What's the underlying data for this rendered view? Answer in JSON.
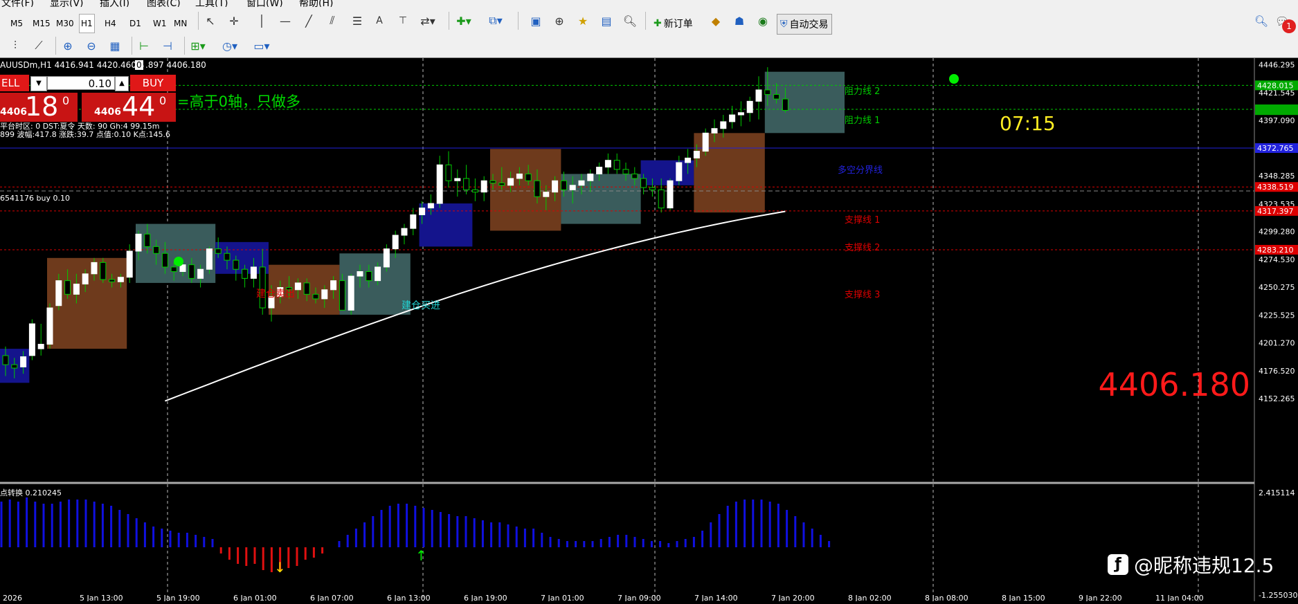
{
  "menu": [
    "文件(F)",
    "显示(V)",
    "插入(I)",
    "图表(C)",
    "工具(T)",
    "窗口(W)",
    "帮助(H)"
  ],
  "timeframes": [
    "M5",
    "M15",
    "M30",
    "H1",
    "H4",
    "D1",
    "W1",
    "MN"
  ],
  "active_timeframe": "H1",
  "toolbar": {
    "new_order_label": "新订单",
    "auto_trading_label": "自动交易",
    "notification_count": "1"
  },
  "chart_header": {
    "symbol_prefix": "AUUSDm,H1",
    "ohlc_partial": "4416.941 4420.460 4",
    "ohlc_badge": "0",
    "ohlc_rest": ".897 4406.180"
  },
  "trade_panel": {
    "sell_label": "ELL",
    "buy_label": "BUY",
    "lot_value": "0.10",
    "sell_prefix": "4406",
    "sell_big": "18",
    "sell_sup": "0",
    "buy_prefix": "4406",
    "buy_big": "44",
    "buy_sup": "0"
  },
  "info_lines": {
    "rule_text": "=高于0轴，只做多",
    "line1": "平台时区: 0  DST:夏令 天数: 90  Gh:4  99.15m",
    "line2": "899  波幅:417.8  涨跌:39.7  点值:0.10  K点:145.6",
    "order_line": "6541176 buy 0.10",
    "countdown": "07:15",
    "big_price": "4406.180"
  },
  "annotations": {
    "resist2": "阻力线 2",
    "resist1": "阻力线 1",
    "pivot": "多空分界线",
    "support1": "支撑线 1",
    "support2": "支撑线 2",
    "support3": "支撑线 3",
    "open_short": "建仓卖出",
    "open_long": "建仓买进"
  },
  "price_axis": {
    "ticks": [
      "4446.295",
      "4421.545",
      "4397.090",
      "4348.285",
      "4323.535",
      "4299.280",
      "4274.530",
      "4250.275",
      "4225.525",
      "4201.270",
      "4176.520",
      "4152.265"
    ],
    "tags": [
      "4428.015",
      "4406.893",
      "4372.765",
      "4338.519",
      "4317.397",
      "4283.210"
    ]
  },
  "indicator": {
    "label": "点转换 0.210245",
    "axis_top": "2.415114",
    "axis_bottom": "-1.255030"
  },
  "time_axis": [
    "2026",
    "5 Jan 13:00",
    "5 Jan 19:00",
    "6 Jan 01:00",
    "6 Jan 07:00",
    "6 Jan 13:00",
    "6 Jan 19:00",
    "7 Jan 01:00",
    "7 Jan 09:00",
    "7 Jan 14:00",
    "7 Jan 20:00",
    "8 Jan 02:00",
    "8 Jan 08:00",
    "8 Jan 15:00",
    "9 Jan 22:00",
    "11 Jan 04:00"
  ],
  "watermark": "@昵称违规12.5",
  "colors": {
    "background": "#000000",
    "bull": "#ffffff",
    "wick": "#00cc00",
    "resistance": "#00cc00",
    "support": "#dd0000",
    "pivot": "#2222dd",
    "box_brown": "#6e3a1c",
    "box_teal": "#3a5c5c",
    "box_blue": "#14148c",
    "hist_blue": "#1010e0",
    "hist_red": "#e01010"
  },
  "chart_data": {
    "type": "candlestick",
    "price_range": [
      4140,
      4452
    ],
    "candles": [
      [
        4190,
        4198,
        4172,
        4182
      ],
      [
        4182,
        4188,
        4170,
        4179
      ],
      [
        4180,
        4194,
        4174,
        4189
      ],
      [
        4190,
        4222,
        4186,
        4218
      ],
      [
        4196,
        4218,
        4190,
        4200
      ],
      [
        4200,
        4236,
        4196,
        4232
      ],
      [
        4234,
        4262,
        4230,
        4256
      ],
      [
        4256,
        4266,
        4240,
        4244
      ],
      [
        4244,
        4262,
        4236,
        4253
      ],
      [
        4253,
        4266,
        4246,
        4262
      ],
      [
        4262,
        4276,
        4256,
        4272
      ],
      [
        4272,
        4276,
        4254,
        4257
      ],
      [
        4257,
        4262,
        4250,
        4255
      ],
      [
        4255,
        4262,
        4250,
        4259
      ],
      [
        4259,
        4288,
        4254,
        4282
      ],
      [
        4282,
        4300,
        4274,
        4297
      ],
      [
        4297,
        4306,
        4280,
        4286
      ],
      [
        4286,
        4292,
        4270,
        4280
      ],
      [
        4280,
        4290,
        4262,
        4268
      ],
      [
        4268,
        4272,
        4256,
        4264
      ],
      [
        4264,
        4274,
        4260,
        4270
      ],
      [
        4270,
        4276,
        4254,
        4258
      ],
      [
        4258,
        4270,
        4250,
        4266
      ],
      [
        4266,
        4286,
        4262,
        4284
      ],
      [
        4284,
        4294,
        4276,
        4280
      ],
      [
        4280,
        4286,
        4266,
        4274
      ],
      [
        4274,
        4278,
        4256,
        4266
      ],
      [
        4266,
        4270,
        4250,
        4258
      ],
      [
        4258,
        4276,
        4250,
        4268
      ],
      [
        4268,
        4284,
        4226,
        4232
      ],
      [
        4232,
        4252,
        4220,
        4242
      ],
      [
        4242,
        4256,
        4236,
        4250
      ],
      [
        4250,
        4260,
        4240,
        4248
      ],
      [
        4248,
        4258,
        4240,
        4254
      ],
      [
        4254,
        4258,
        4238,
        4244
      ],
      [
        4244,
        4250,
        4236,
        4240
      ],
      [
        4240,
        4252,
        4232,
        4248
      ],
      [
        4248,
        4260,
        4240,
        4256
      ],
      [
        4256,
        4262,
        4236,
        4230
      ],
      [
        4230,
        4262,
        4226,
        4260
      ],
      [
        4260,
        4270,
        4250,
        4264
      ],
      [
        4264,
        4270,
        4250,
        4256
      ],
      [
        4256,
        4272,
        4252,
        4268
      ],
      [
        4268,
        4288,
        4264,
        4284
      ],
      [
        4284,
        4300,
        4276,
        4296
      ],
      [
        4296,
        4306,
        4288,
        4302
      ],
      [
        4302,
        4320,
        4296,
        4314
      ],
      [
        4314,
        4326,
        4306,
        4320
      ],
      [
        4320,
        4332,
        4314,
        4324
      ],
      [
        4324,
        4366,
        4320,
        4358
      ],
      [
        4358,
        4370,
        4338,
        4344
      ],
      [
        4344,
        4354,
        4330,
        4346
      ],
      [
        4346,
        4358,
        4332,
        4336
      ],
      [
        4336,
        4346,
        4326,
        4334
      ],
      [
        4334,
        4348,
        4326,
        4344
      ],
      [
        4344,
        4350,
        4336,
        4342
      ],
      [
        4342,
        4356,
        4336,
        4340
      ],
      [
        4340,
        4352,
        4334,
        4346
      ],
      [
        4346,
        4356,
        4340,
        4350
      ],
      [
        4350,
        4358,
        4340,
        4344
      ],
      [
        4344,
        4354,
        4324,
        4330
      ],
      [
        4330,
        4340,
        4318,
        4334
      ],
      [
        4334,
        4348,
        4326,
        4344
      ],
      [
        4344,
        4352,
        4330,
        4336
      ],
      [
        4336,
        4348,
        4324,
        4340
      ],
      [
        4340,
        4350,
        4332,
        4344
      ],
      [
        4344,
        4354,
        4334,
        4350
      ],
      [
        4350,
        4360,
        4344,
        4356
      ],
      [
        4356,
        4368,
        4350,
        4362
      ],
      [
        4362,
        4368,
        4350,
        4354
      ],
      [
        4354,
        4360,
        4344,
        4350
      ],
      [
        4350,
        4356,
        4340,
        4346
      ],
      [
        4346,
        4350,
        4332,
        4338
      ],
      [
        4338,
        4346,
        4330,
        4336
      ],
      [
        4336,
        4346,
        4316,
        4320
      ],
      [
        4320,
        4346,
        4318,
        4344
      ],
      [
        4344,
        4366,
        4340,
        4360
      ],
      [
        4360,
        4372,
        4350,
        4364
      ],
      [
        4364,
        4376,
        4356,
        4370
      ],
      [
        4370,
        4390,
        4366,
        4386
      ],
      [
        4386,
        4398,
        4378,
        4390
      ],
      [
        4390,
        4402,
        4382,
        4396
      ],
      [
        4396,
        4410,
        4390,
        4402
      ],
      [
        4402,
        4414,
        4392,
        4404
      ],
      [
        4404,
        4418,
        4396,
        4414
      ],
      [
        4414,
        4436,
        4398,
        4424
      ],
      [
        4424,
        4444,
        4410,
        4420
      ],
      [
        4420,
        4430,
        4412,
        4416
      ],
      [
        4416,
        4426,
        4404,
        4406
      ]
    ],
    "ma_range": [
      4150,
      4317
    ],
    "histogram": [
      2.2,
      2.3,
      2.2,
      2.4,
      2.2,
      2.1,
      2.1,
      2.2,
      2.3,
      2.3,
      2.3,
      2.2,
      2.1,
      2.0,
      1.8,
      1.6,
      1.4,
      1.2,
      1.0,
      0.9,
      0.8,
      0.7,
      0.7,
      0.6,
      0.5,
      0.4,
      -0.3,
      -0.6,
      -0.8,
      -0.9,
      -0.8,
      -1.1,
      -1.2,
      -1.1,
      -1.0,
      -0.9,
      -0.6,
      -0.5,
      -0.3,
      0.0,
      0.3,
      0.6,
      0.9,
      1.2,
      1.5,
      1.8,
      2.0,
      2.1,
      2.1,
      2.0,
      1.9,
      1.8,
      1.7,
      1.6,
      1.5,
      1.5,
      1.4,
      1.3,
      1.2,
      1.2,
      1.1,
      1.0,
      0.9,
      0.9,
      0.7,
      0.5,
      0.4,
      0.3,
      0.3,
      0.3,
      0.3,
      0.4,
      0.5,
      0.6,
      0.6,
      0.5,
      0.4,
      0.3,
      0.3,
      0.2,
      0.3,
      0.4,
      0.5,
      0.8,
      1.2,
      1.6,
      2.0,
      2.2,
      2.3,
      2.3,
      2.3,
      2.2,
      2.1,
      1.8,
      1.5,
      1.2,
      0.9,
      0.6,
      0.3
    ]
  }
}
